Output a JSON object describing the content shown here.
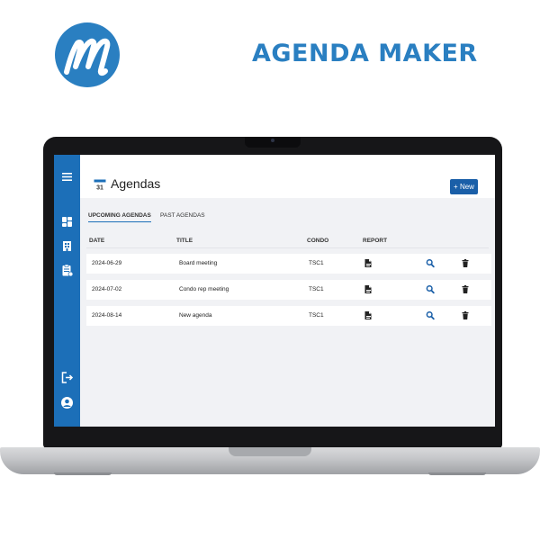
{
  "promo": {
    "title": "AGENDA MAKER",
    "logo_icon": "m-logo"
  },
  "colors": {
    "brand_blue": "#2a7fc1",
    "sidebar_blue": "#1c6fb8",
    "button_blue": "#1a5fa8"
  },
  "sidebar": {
    "top_icons": [
      "menu-icon",
      "dashboard-icon",
      "building-icon",
      "clipboard-icon"
    ],
    "bottom_icons": [
      "logout-icon",
      "account-icon"
    ]
  },
  "header": {
    "calendar_day": "31",
    "title": "Agendas",
    "new_button": "+ New"
  },
  "tabs": [
    {
      "label": "UPCOMING AGENDAS",
      "active": true
    },
    {
      "label": "PAST AGENDAS",
      "active": false
    }
  ],
  "table": {
    "columns": [
      "DATE",
      "TITLE",
      "CONDO",
      "REPORT"
    ],
    "rows": [
      {
        "date": "2024-06-29",
        "title": "Board meeting",
        "condo": "TSC1"
      },
      {
        "date": "2024-07-02",
        "title": "Condo rep meeting",
        "condo": "TSC1"
      },
      {
        "date": "2024-08-14",
        "title": "New agenda",
        "condo": "TSC1"
      }
    ],
    "row_actions": [
      "report-icon",
      "search-icon",
      "trash-icon"
    ]
  }
}
